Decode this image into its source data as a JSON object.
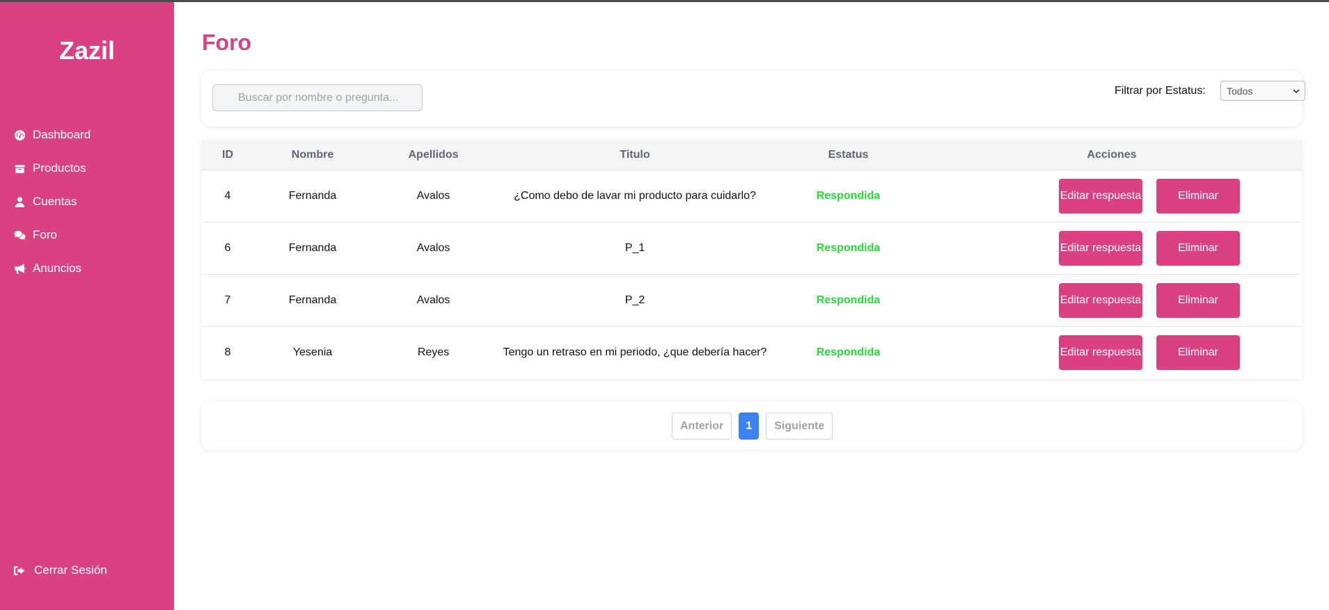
{
  "sidebar": {
    "brand": "Zazil",
    "items": [
      {
        "label": "Dashboard",
        "icon": "gauge-icon"
      },
      {
        "label": "Productos",
        "icon": "box-icon"
      },
      {
        "label": "Cuentas",
        "icon": "user-icon"
      },
      {
        "label": "Foro",
        "icon": "comments-icon"
      },
      {
        "label": "Anuncios",
        "icon": "megaphone-icon"
      }
    ],
    "logout": {
      "label": "Cerrar Sesión",
      "icon": "sign-out-icon"
    }
  },
  "page": {
    "title": "Foro"
  },
  "filters": {
    "search_placeholder": "Buscar por nombre o pregunta...",
    "search_value": "",
    "status_label": "Filtrar por Estatus:",
    "status_selected": "Todos"
  },
  "table": {
    "headers": {
      "id": "ID",
      "nombre": "Nombre",
      "apellidos": "Apellidos",
      "titulo": "Titulo",
      "estatus": "Estatus",
      "acciones": "Acciones"
    },
    "edit_label": "Editar respuesta",
    "delete_label": "Eliminar",
    "rows": [
      {
        "id": "4",
        "nombre": "Fernanda",
        "apellidos": "Avalos",
        "titulo": "¿Como debo de lavar mi producto para cuidarlo?",
        "estatus": "Respondida"
      },
      {
        "id": "6",
        "nombre": "Fernanda",
        "apellidos": "Avalos",
        "titulo": "P_1",
        "estatus": "Respondida"
      },
      {
        "id": "7",
        "nombre": "Fernanda",
        "apellidos": "Avalos",
        "titulo": "P_2",
        "estatus": "Respondida"
      },
      {
        "id": "8",
        "nombre": "Yesenia",
        "apellidos": "Reyes",
        "titulo": "Tengo un retraso en mi periodo, ¿que debería hacer?",
        "estatus": "Respondida"
      }
    ]
  },
  "pagination": {
    "prev_label": "Anterior",
    "current_page": "1",
    "next_label": "Siguiente"
  },
  "colors": {
    "brand": "#d94183",
    "status_answered": "#22dd33",
    "active_page": "#3b82f6"
  }
}
